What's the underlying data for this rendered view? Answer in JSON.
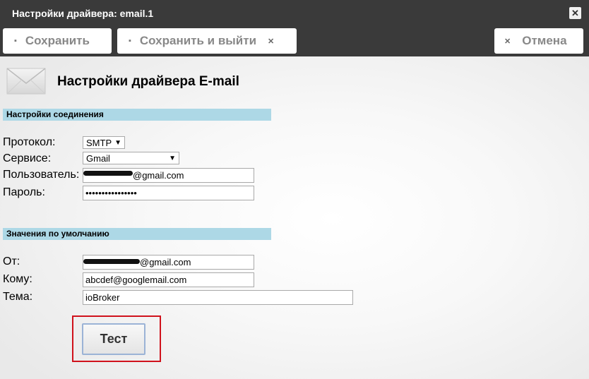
{
  "window": {
    "title": "Настройки драйвера: email.1",
    "close_label": "✕"
  },
  "toolbar": {
    "save_label": "Сохранить",
    "save_exit_label": "Сохранить и выйти",
    "cancel_label": "Отмена"
  },
  "page": {
    "title": "Настройки драйвера E-mail"
  },
  "connection": {
    "header": "Настройки соединения",
    "protocol_label": "Протокол:",
    "protocol_value": "SMTP",
    "service_label": "Сервисе:",
    "service_value": "Gmail",
    "user_label": "Пользователь:",
    "user_value": "@gmail.com",
    "password_label": "Пароль:",
    "password_value": "••••••••••••••••"
  },
  "defaults": {
    "header": "Значения по умолчанию",
    "from_label": "От:",
    "from_value": "@gmail.com",
    "to_label": "Кому:",
    "to_value": "abcdef@googlemail.com",
    "subject_label": "Тема:",
    "subject_value": "ioBroker"
  },
  "test_button": {
    "label": "Тест"
  },
  "icons": {
    "save": "floppy-icon",
    "close": "close-icon",
    "mail": "envelope-icon"
  },
  "colors": {
    "titlebar": "#3a3a3a",
    "section_header": "#add8e6",
    "highlight": "#d0121c"
  }
}
